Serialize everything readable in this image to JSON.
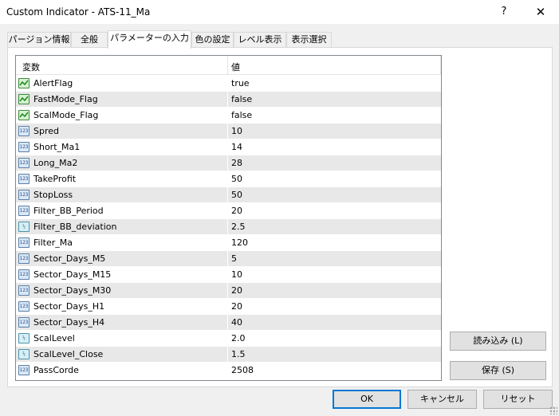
{
  "window": {
    "title": "Custom Indicator - ATS-11_Ma",
    "help_label": "?",
    "close_label": "✕"
  },
  "tabs": [
    {
      "label": "パージョン情報",
      "active": false
    },
    {
      "label": "全般",
      "active": false
    },
    {
      "label": "パラメーターの入力",
      "active": true
    },
    {
      "label": "色の設定",
      "active": false
    },
    {
      "label": "レベル表示",
      "active": false
    },
    {
      "label": "表示選択",
      "active": false
    }
  ],
  "grid": {
    "headers": {
      "variable": "変数",
      "value": "値"
    },
    "rows": [
      {
        "icon": "bool",
        "icon_text": "",
        "name": "AlertFlag",
        "value": "true"
      },
      {
        "icon": "bool",
        "icon_text": "",
        "name": "FastMode_Flag",
        "value": "false"
      },
      {
        "icon": "bool",
        "icon_text": "",
        "name": "ScalMode_Flag",
        "value": "false"
      },
      {
        "icon": "int",
        "icon_text": "123",
        "name": "Spred",
        "value": "10"
      },
      {
        "icon": "int",
        "icon_text": "123",
        "name": "Short_Ma1",
        "value": "14"
      },
      {
        "icon": "int",
        "icon_text": "123",
        "name": "Long_Ma2",
        "value": "28"
      },
      {
        "icon": "int",
        "icon_text": "123",
        "name": "TakeProfit",
        "value": "50"
      },
      {
        "icon": "int",
        "icon_text": "123",
        "name": "StopLoss",
        "value": "50"
      },
      {
        "icon": "int",
        "icon_text": "123",
        "name": "Filter_BB_Period",
        "value": "20"
      },
      {
        "icon": "double",
        "icon_text": "½",
        "name": "Filter_BB_deviation",
        "value": "2.5"
      },
      {
        "icon": "int",
        "icon_text": "123",
        "name": "Filter_Ma",
        "value": "120"
      },
      {
        "icon": "int",
        "icon_text": "123",
        "name": "Sector_Days_M5",
        "value": "5"
      },
      {
        "icon": "int",
        "icon_text": "123",
        "name": "Sector_Days_M15",
        "value": "10"
      },
      {
        "icon": "int",
        "icon_text": "123",
        "name": "Sector_Days_M30",
        "value": "20"
      },
      {
        "icon": "int",
        "icon_text": "123",
        "name": "Sector_Days_H1",
        "value": "20"
      },
      {
        "icon": "int",
        "icon_text": "123",
        "name": "Sector_Days_H4",
        "value": "40"
      },
      {
        "icon": "double",
        "icon_text": "½",
        "name": "ScalLevel",
        "value": "2.0"
      },
      {
        "icon": "double",
        "icon_text": "½",
        "name": "ScalLevel_Close",
        "value": "1.5"
      },
      {
        "icon": "int",
        "icon_text": "123",
        "name": "PassCorde",
        "value": "2508"
      }
    ]
  },
  "side_buttons": {
    "load": "読み込み (L)",
    "save": "保存 (S)"
  },
  "footer_buttons": {
    "ok": "OK",
    "cancel": "キャンセル",
    "reset": "リセット"
  },
  "colors": {
    "accent": "#0078d7",
    "row_alt": "#e8e8e8"
  }
}
